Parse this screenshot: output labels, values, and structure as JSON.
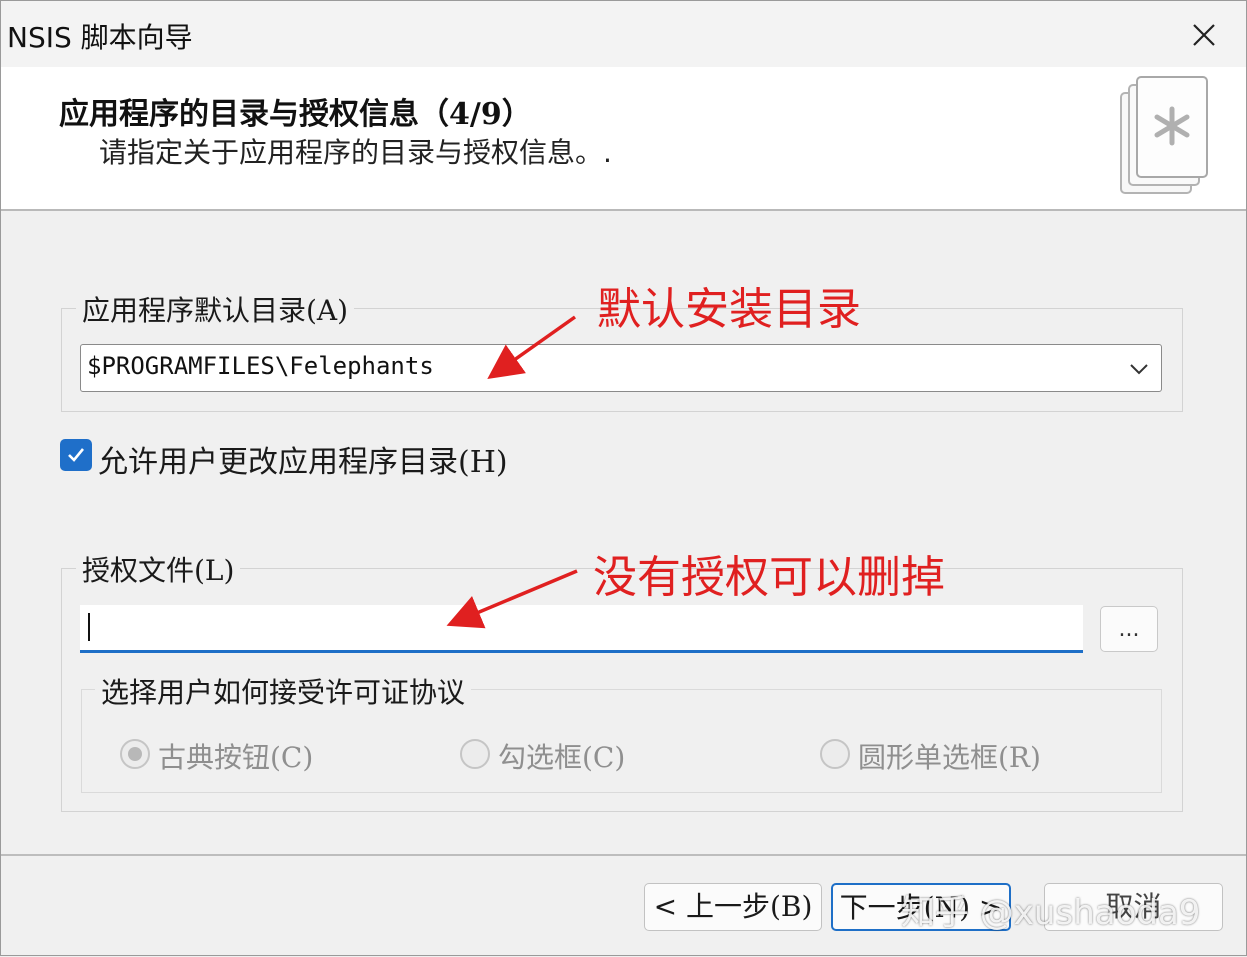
{
  "window": {
    "title": "NSIS 脚本向导",
    "close_icon": "close-icon"
  },
  "header": {
    "title": "应用程序的目录与授权信息（4/9）",
    "subtitle": "请指定关于应用程序的目录与授权信息。.",
    "icon": "document-star-icon"
  },
  "app_dir": {
    "group_label": "应用程序默认目录(A)",
    "value": "$PROGRAMFILES\\Felephants",
    "chevron_icon": "chevron-down-icon"
  },
  "allow_change": {
    "label": "允许用户更改应用程序目录(H)",
    "checked": true
  },
  "license": {
    "group_label": "授权文件(L)",
    "value": "",
    "browse_label": "...",
    "accept_group_label": "选择用户如何接受许可证协议",
    "options": [
      {
        "label": "古典按钮(C)",
        "selected": true
      },
      {
        "label": "勾选框(C)",
        "selected": false
      },
      {
        "label": "圆形单选框(R)",
        "selected": false
      }
    ]
  },
  "buttons": {
    "back": "< 上一步(B)",
    "next": "下一步(N) >",
    "cancel": "取消"
  },
  "annotations": {
    "default_dir": "默认安装目录",
    "license_note": "没有授权可以删掉",
    "color": "#e02020"
  },
  "watermark": "知乎 @xushaoda9"
}
